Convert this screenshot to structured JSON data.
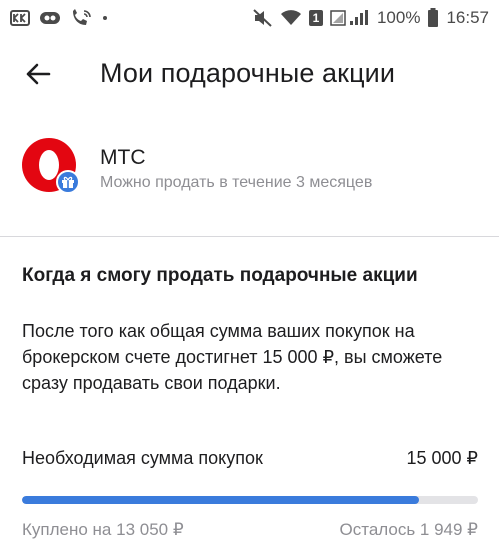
{
  "statusbar": {
    "icons_left": [
      "vk-icon",
      "app-icon",
      "wifi-call-icon",
      "dot-icon"
    ],
    "sim_label": "1",
    "battery_percent": "100%",
    "time": "16:57"
  },
  "appbar": {
    "title": "Мои подарочные акции"
  },
  "company": {
    "name": "МТС",
    "subtitle": "Можно продать в течение 3 месяцев",
    "logo_color": "#e30611"
  },
  "info": {
    "heading": "Когда я смогу продать подарочные акции",
    "text": "После того как общая сумма ваших покупок на брокерском счете достигнет 15 000 ₽, вы сможете сразу продавать свои подарки."
  },
  "progress": {
    "label": "Необходимая сумма покупок",
    "total": "15 000 ₽",
    "fraction": 0.87,
    "bought": "Куплено на 13 050 ₽",
    "remaining": "Осталось 1 949 ₽",
    "fill_color": "#3a7bdc"
  }
}
